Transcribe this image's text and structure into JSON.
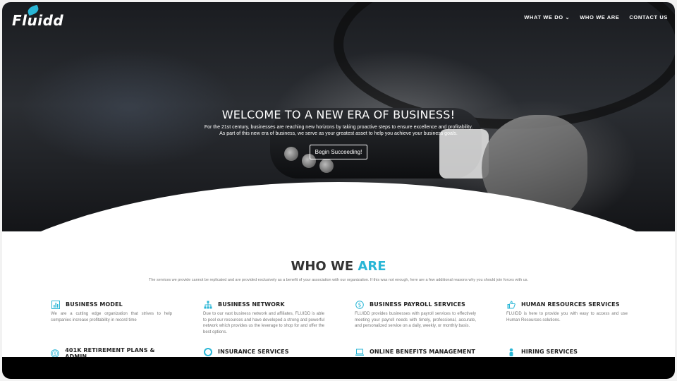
{
  "brand": {
    "name": "Fluidd",
    "accent": "#29b6d6"
  },
  "nav": [
    {
      "label": "WHAT WE DO",
      "has_dropdown": true
    },
    {
      "label": "WHO WE ARE",
      "has_dropdown": false
    },
    {
      "label": "CONTACT US",
      "has_dropdown": false
    }
  ],
  "hero": {
    "title": "WELCOME TO A NEW ERA OF BUSINESS!",
    "line1": "For the 21st century, businesses are reaching new horizons by taking proactive steps to ensure excellence and profitability.",
    "line2": "As part of this new era of business, we serve as your greatest asset to help you achieve your business goals.",
    "cta": "Begin Succeeding!"
  },
  "who": {
    "title_main": "WHO WE ",
    "title_accent": "ARE",
    "subtitle": "The services we provide cannot be replicated and are provided exclusively as a benefit of your association with our organization. If this was not enough, here are a few additional reasons why you should join forces with us."
  },
  "services": [
    {
      "icon": "bar-chart-icon",
      "title": "BUSINESS MODEL",
      "desc": "We are a cutting edge organization that strives to help companies increase profitability in record time"
    },
    {
      "icon": "network-icon",
      "title": "BUSINESS NETWORK",
      "desc": "Due to our vast business network and affiliates, FLUIDD is able to pool our resources and have developed a strong and powerful network which provides us the leverage to shop for and offer the best options."
    },
    {
      "icon": "dollar-icon",
      "title": "BUSINESS PAYROLL SERVICES",
      "desc": "FLUIDD provides businesses with payroll services to effectively meeting your payroll needs with timely, professional, accurate, and personalized service on a daily, weekly, or monthly basis."
    },
    {
      "icon": "thumbs-up-icon",
      "title": "HUMAN RESOURCES SERVICES",
      "desc": "FLUIDD is here to provide you with easy to access and use Human Resources solutions."
    },
    {
      "icon": "dollar-circle-icon",
      "title": "401K RETIREMENT PLANS & ADMIN",
      "desc": ""
    },
    {
      "icon": "lifebuoy-icon",
      "title": "INSURANCE SERVICES",
      "desc": ""
    },
    {
      "icon": "laptop-icon",
      "title": "ONLINE BENEFITS MANAGEMENT",
      "desc": ""
    },
    {
      "icon": "person-icon",
      "title": "HIRING SERVICES",
      "desc": ""
    }
  ]
}
